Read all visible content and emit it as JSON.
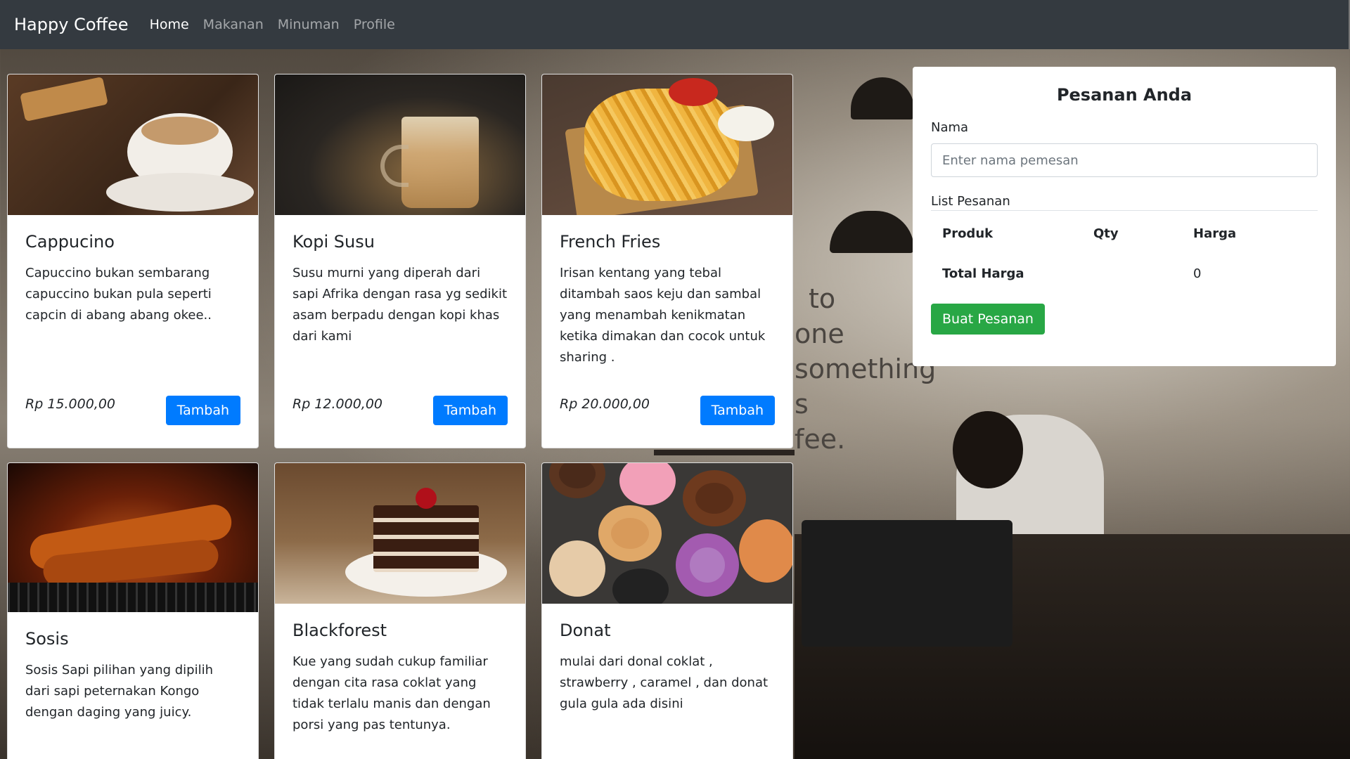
{
  "navbar": {
    "brand": "Happy Coffee",
    "links": [
      "Home",
      "Makanan",
      "Minuman",
      "Profile"
    ],
    "active": "Home"
  },
  "products": [
    {
      "name": "Cappucino",
      "description": "Capuccino bukan sembarang capuccino bukan pula seperti capcin di abang abang okee..",
      "price": "Rp 15.000,00",
      "button": "Tambah",
      "image_icon": "cappuccino-image"
    },
    {
      "name": "Kopi Susu",
      "description": "Susu murni yang diperah dari sapi Afrika dengan rasa yg sedikit asam berpadu dengan kopi khas dari kami",
      "price": "Rp 12.000,00",
      "button": "Tambah",
      "image_icon": "kopi-susu-image"
    },
    {
      "name": "French Fries",
      "description": "Irisan kentang yang tebal ditambah saos keju dan sambal yang menambah kenikmatan ketika dimakan dan cocok untuk sharing .",
      "price": "Rp 20.000,00",
      "button": "Tambah",
      "image_icon": "french-fries-image"
    },
    {
      "name": "Sosis",
      "description": "Sosis Sapi pilihan yang dipilih dari sapi peternakan Kongo dengan daging yang juicy.",
      "image_icon": "sosis-image"
    },
    {
      "name": "Blackforest",
      "description": "Kue yang sudah cukup familiar dengan cita rasa coklat yang tidak terlalu manis dan dengan porsi yang pas tentunya.",
      "image_icon": "blackforest-image"
    },
    {
      "name": "Donat",
      "description": "mulai dari donal coklat , strawberry , caramel , dan donat gula gula ada disini",
      "image_icon": "donat-image"
    }
  ],
  "order_panel": {
    "title": "Pesanan Anda",
    "name_label": "Nama",
    "name_placeholder": "Enter nama pemesan",
    "name_value": "",
    "list_label": "List Pesanan",
    "columns": [
      "Produk",
      "Qty",
      "Harga"
    ],
    "total_label": "Total Harga",
    "total_value": "0",
    "submit_label": "Buat Pesanan"
  },
  "background": {
    "wall_text": [
      "to",
      "one",
      "something",
      "s",
      "fee."
    ]
  },
  "colors": {
    "navbar": "#343a40",
    "primary": "#007bff",
    "success": "#28a745"
  }
}
